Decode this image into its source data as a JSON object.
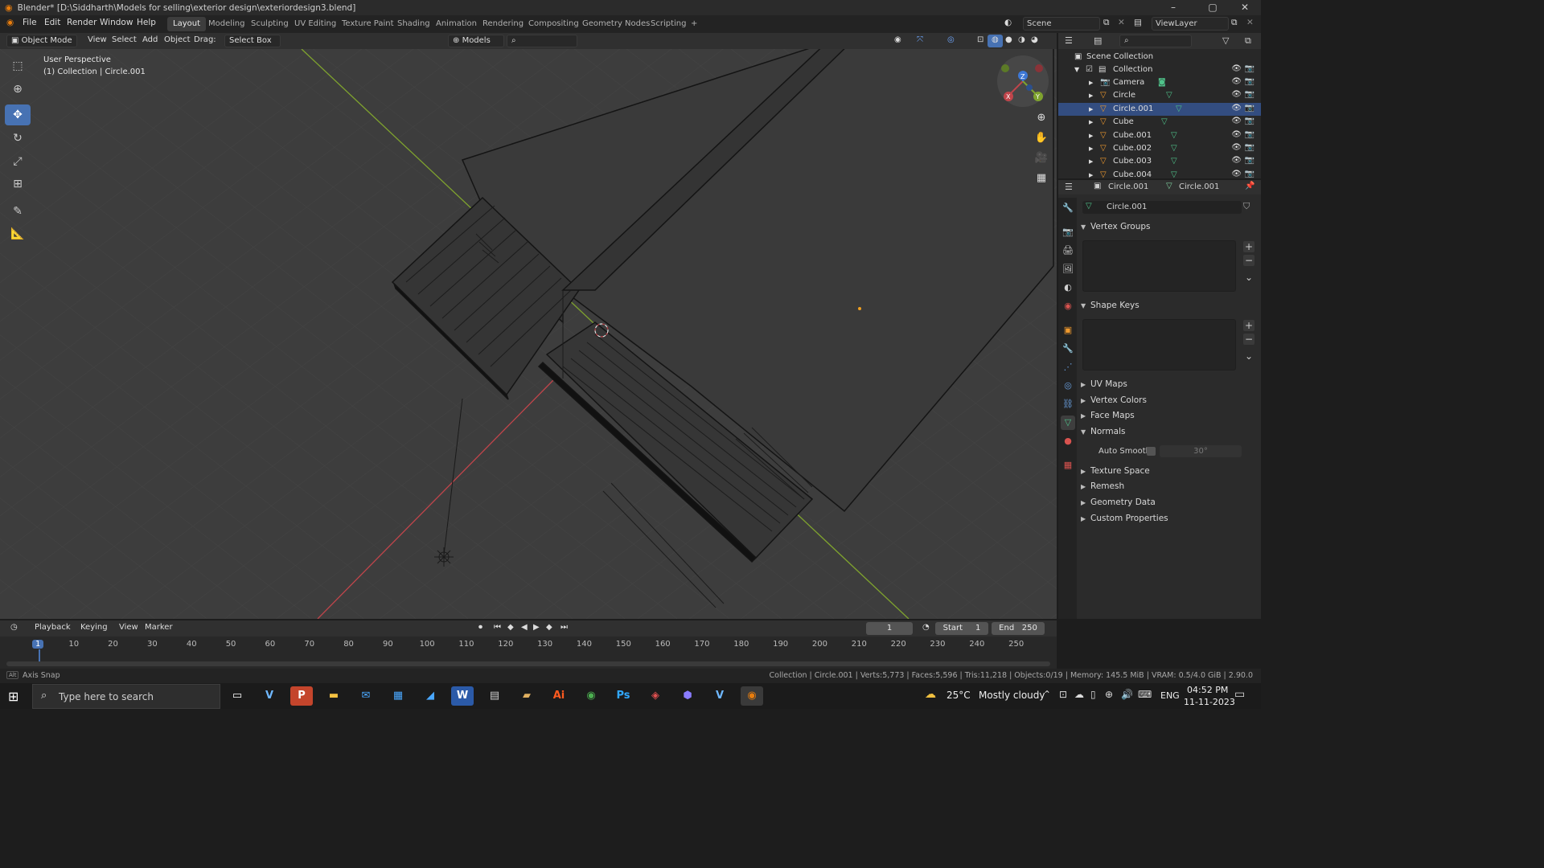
{
  "window": {
    "title": "Blender* [D:\\Siddharth\\Models for selling\\exterior design\\exteriordesign3.blend]",
    "minimize": "–",
    "maximize": "▢",
    "close": "✕"
  },
  "menus": [
    "File",
    "Edit",
    "Render",
    "Window",
    "Help"
  ],
  "workspaces": [
    "Layout",
    "Modeling",
    "Sculpting",
    "UV Editing",
    "Texture Paint",
    "Shading",
    "Animation",
    "Rendering",
    "Compositing",
    "Geometry Nodes",
    "Scripting",
    "+"
  ],
  "active_workspace": "Layout",
  "scene": "Scene",
  "view_layer": "ViewLayer",
  "viewport_header": {
    "mode": "Object Mode",
    "view": "View",
    "select": "Select",
    "add": "Add",
    "object": "Object",
    "drag_label": "Drag:",
    "drag_value": "Select Box",
    "orientation": "Models"
  },
  "viewport": {
    "perspective_label": "User Perspective",
    "collection_label": "(1) Collection | Circle.001",
    "gizmo": {
      "x": "X",
      "y": "Y",
      "z": "Z"
    }
  },
  "outliner": {
    "root": "Scene Collection",
    "collection": "Collection",
    "items": [
      {
        "name": "Camera",
        "selected": false
      },
      {
        "name": "Circle",
        "selected": false
      },
      {
        "name": "Circle.001",
        "selected": true
      },
      {
        "name": "Cube",
        "selected": false
      },
      {
        "name": "Cube.001",
        "selected": false
      },
      {
        "name": "Cube.002",
        "selected": false
      },
      {
        "name": "Cube.003",
        "selected": false
      },
      {
        "name": "Cube.004",
        "selected": false
      }
    ]
  },
  "properties": {
    "object_name": "Circle.001",
    "mesh_name": "Circle.001",
    "data_name": "Circle.001",
    "sections": {
      "vertex_groups": "Vertex Groups",
      "shape_keys": "Shape Keys",
      "uv_maps": "UV Maps",
      "vertex_colors": "Vertex Colors",
      "face_maps": "Face Maps",
      "normals": "Normals",
      "auto_smooth": "Auto Smooth",
      "auto_smooth_angle": "30°",
      "texture_space": "Texture Space",
      "remesh": "Remesh",
      "geometry_data": "Geometry Data",
      "custom_properties": "Custom Properties"
    }
  },
  "timeline": {
    "playback": "Playback",
    "keying": "Keying",
    "view": "View",
    "marker": "Marker",
    "current_frame": "1",
    "start_label": "Start",
    "start": "1",
    "end_label": "End",
    "end": "250",
    "ticks": [
      "1",
      "10",
      "20",
      "30",
      "40",
      "50",
      "60",
      "70",
      "80",
      "90",
      "100",
      "110",
      "120",
      "130",
      "140",
      "150",
      "160",
      "170",
      "180",
      "190",
      "200",
      "210",
      "220",
      "230",
      "240",
      "250"
    ]
  },
  "statusbar": {
    "left": "Axis Snap",
    "right": "Collection | Circle.001 | Verts:5,773 | Faces:5,596 | Tris:11,218 | Objects:0/19 | Memory: 145.5 MiB | VRAM: 0.5/4.0 GiB | 2.90.0"
  },
  "taskbar": {
    "search_placeholder": "Type here to search",
    "weather_temp": "25°C",
    "weather_desc": "Mostly cloudy",
    "language": "ENG",
    "time": "04:52 PM",
    "date": "11-11-2023"
  },
  "colors": {
    "accent": "#4772b3",
    "selected_row": "#334d80",
    "x_axis": "#c0454b",
    "y_axis": "#7fa32e",
    "viewport_bg": "#3d3d3d"
  }
}
